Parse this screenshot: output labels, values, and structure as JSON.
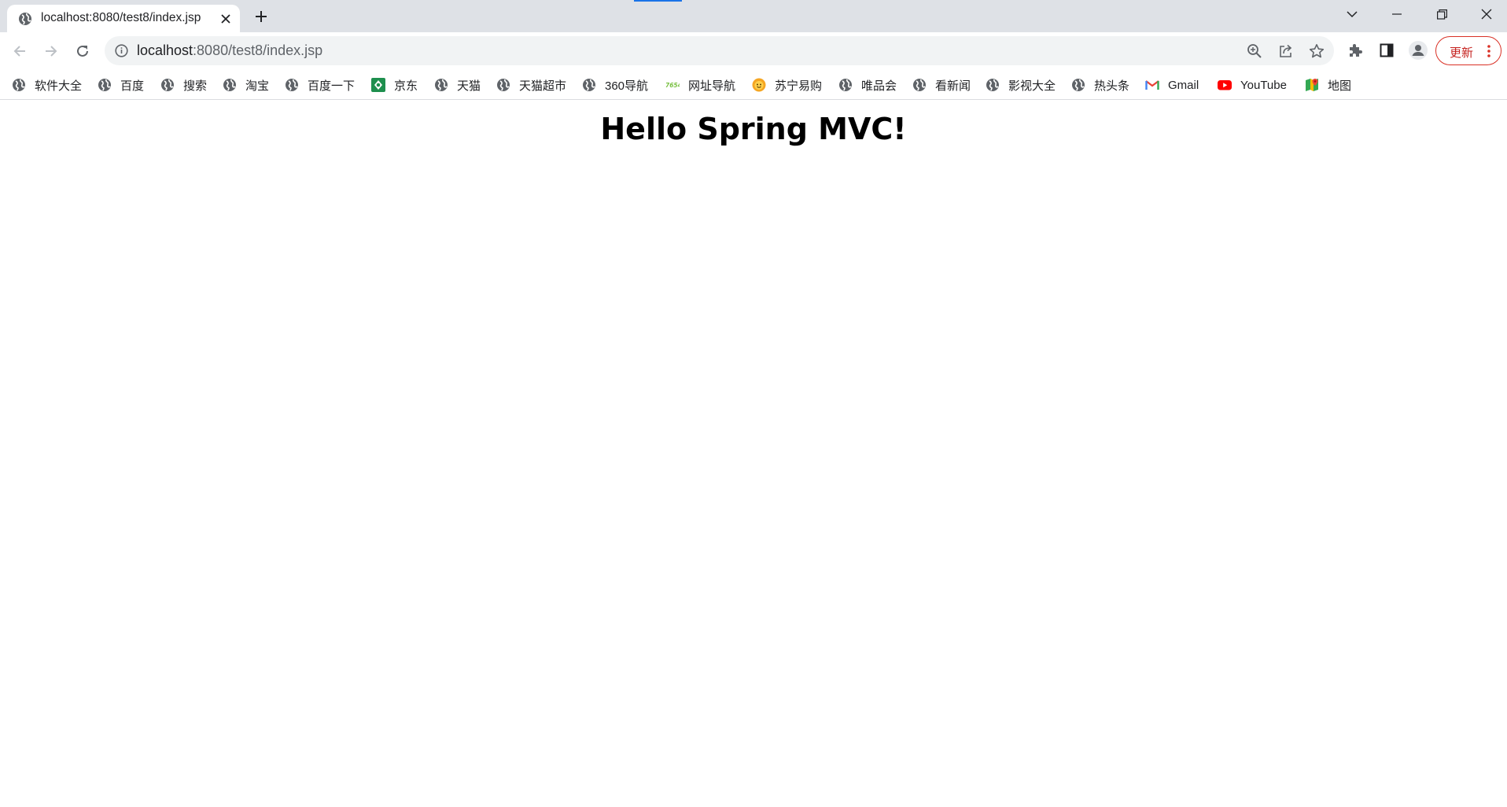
{
  "tab": {
    "title": "localhost:8080/test8/index.jsp",
    "favicon": "globe-icon"
  },
  "omnibox": {
    "url_host": "localhost",
    "url_rest": ":8080/test8/index.jsp"
  },
  "update_button": {
    "label": "更新"
  },
  "bookmarks": [
    {
      "label": "软件大全",
      "icon": "globe-icon"
    },
    {
      "label": "百度",
      "icon": "globe-icon"
    },
    {
      "label": "搜索",
      "icon": "globe-icon"
    },
    {
      "label": "淘宝",
      "icon": "globe-icon"
    },
    {
      "label": "百度一下",
      "icon": "globe-icon"
    },
    {
      "label": "京东",
      "icon": "jd-icon"
    },
    {
      "label": "天猫",
      "icon": "globe-icon"
    },
    {
      "label": "天猫超市",
      "icon": "globe-icon"
    },
    {
      "label": "360导航",
      "icon": "globe-icon"
    },
    {
      "label": "网址导航",
      "icon": "7654-icon"
    },
    {
      "label": "苏宁易购",
      "icon": "suning-icon"
    },
    {
      "label": "唯品会",
      "icon": "globe-icon"
    },
    {
      "label": "看新闻",
      "icon": "globe-icon"
    },
    {
      "label": "影视大全",
      "icon": "globe-icon"
    },
    {
      "label": "热头条",
      "icon": "globe-icon"
    },
    {
      "label": "Gmail",
      "icon": "gmail-icon"
    },
    {
      "label": "YouTube",
      "icon": "youtube-icon"
    },
    {
      "label": "地图",
      "icon": "maps-icon"
    }
  ],
  "page": {
    "heading": "Hello Spring MVC!"
  },
  "colors": {
    "tabstrip_bg": "#dee1e6",
    "omnibox_bg": "#f1f3f4",
    "accent": "#1a73e8",
    "update_red": "#d93025"
  }
}
